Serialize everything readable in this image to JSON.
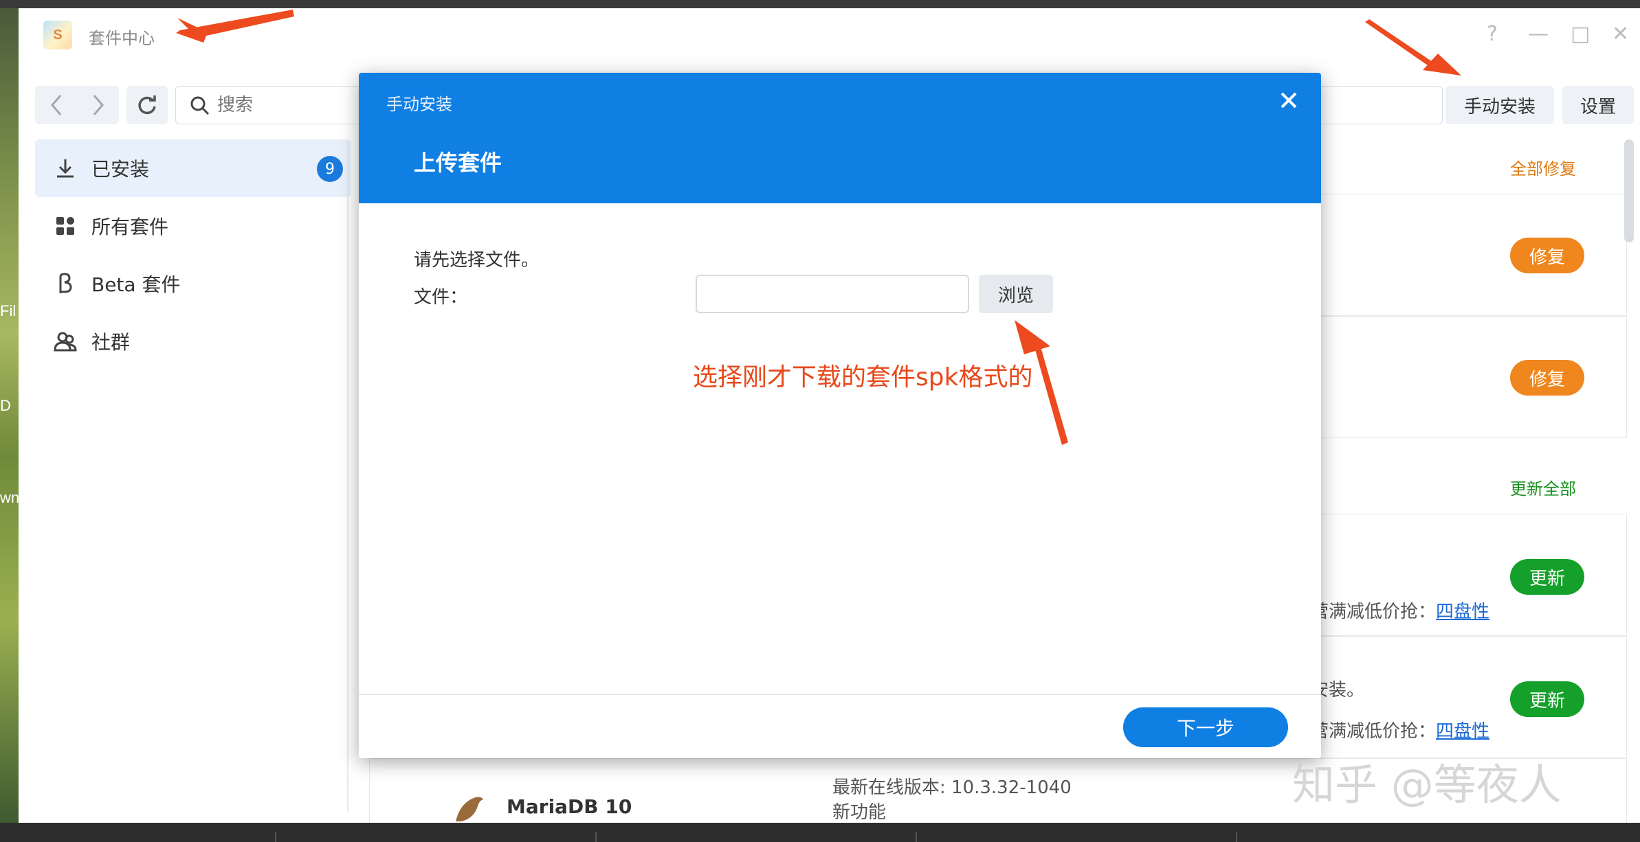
{
  "desktop": {
    "left_fragments": [
      "Fil",
      "D",
      "wn"
    ]
  },
  "window": {
    "title": "套件中心",
    "help_icon": "?",
    "minimize_icon": "—",
    "maximize_icon": "□",
    "close_icon": "✕"
  },
  "toolbar": {
    "search_placeholder": "搜索",
    "manual_install_label": "手动安装",
    "settings_label": "设置"
  },
  "sidebar": {
    "items": [
      {
        "label": "已安装",
        "icon": "download-icon",
        "badge": "9",
        "active": true
      },
      {
        "label": "所有套件",
        "icon": "grid-icon"
      },
      {
        "label": "Beta 套件",
        "icon": "beta-icon"
      },
      {
        "label": "社群",
        "icon": "community-icon"
      }
    ]
  },
  "content": {
    "repair_all_label": "全部修复",
    "update_all_label": "更新全部",
    "repair_label": "修复",
    "update_label": "更新",
    "row_text_1": "营满减低价抢：",
    "row_link_1": "四盘性",
    "row_text_2": "安装。",
    "row_text_3": "营满减低价抢：",
    "row_link_3": "四盘性",
    "mariadb_name": "MariaDB 10",
    "mariadb_version": "最新在线版本: 10.3.32-1040",
    "mariadb_new": "新功能"
  },
  "modal": {
    "title": "手动安装",
    "subtitle": "上传套件",
    "prompt": "请先选择文件。",
    "file_label": "文件：",
    "file_value": "",
    "browse_label": "浏览",
    "next_label": "下一步"
  },
  "annotation": {
    "text": "选择刚才下载的套件spk格式的"
  },
  "watermark": "知乎 @等夜人",
  "colors": {
    "accent_blue": "#0f7fe4",
    "repair_orange": "#f0861e",
    "update_green": "#14a02a",
    "annotation_red": "#e8491a"
  }
}
